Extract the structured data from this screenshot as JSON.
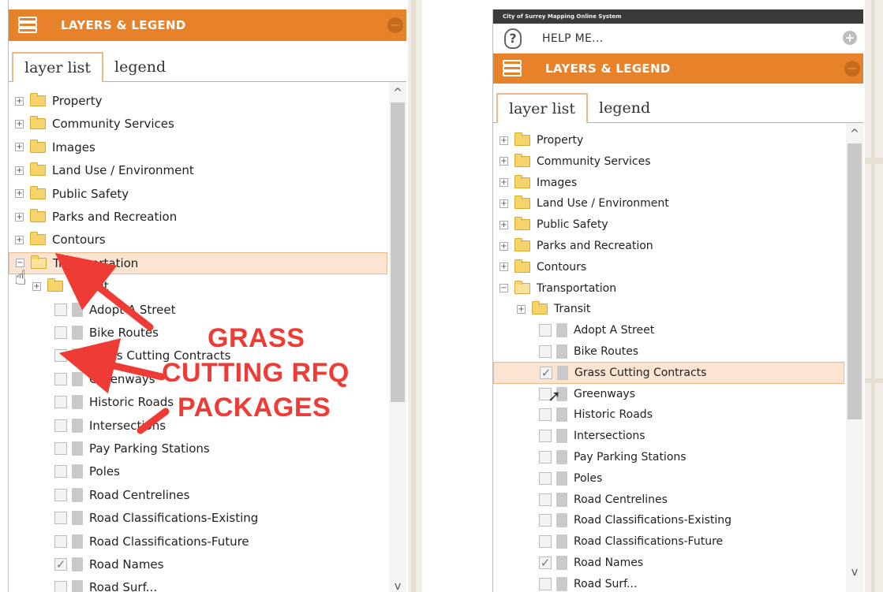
{
  "left": {
    "header_title": "LAYERS & LEGEND",
    "tabs": [
      "layer list",
      "legend"
    ],
    "items": [
      {
        "kind": "folder",
        "expander": "+",
        "label": "Property"
      },
      {
        "kind": "folder",
        "expander": "+",
        "label": "Community Services"
      },
      {
        "kind": "folder",
        "expander": "+",
        "label": "Images"
      },
      {
        "kind": "folder",
        "expander": "+",
        "label": "Land Use / Environment"
      },
      {
        "kind": "folder",
        "expander": "+",
        "label": "Public Safety"
      },
      {
        "kind": "folder",
        "expander": "+",
        "label": "Parks and Recreation"
      },
      {
        "kind": "folder",
        "expander": "+",
        "label": "Contours"
      },
      {
        "kind": "folder",
        "expander": "−",
        "label": "Transportation",
        "open": true,
        "selected": true
      },
      {
        "kind": "folder",
        "expander": "+",
        "label": "Transit",
        "indent": 1
      },
      {
        "kind": "layer",
        "label": "Adopt A Street",
        "checked": false
      },
      {
        "kind": "layer",
        "label": "Bike Routes",
        "checked": false
      },
      {
        "kind": "layer",
        "label": "Grass Cutting Contracts",
        "checked": false
      },
      {
        "kind": "layer",
        "label": "Greenways",
        "checked": false
      },
      {
        "kind": "layer",
        "label": "Historic Roads",
        "checked": false
      },
      {
        "kind": "layer",
        "label": "Intersections",
        "checked": false
      },
      {
        "kind": "layer",
        "label": "Pay Parking Stations",
        "checked": false
      },
      {
        "kind": "layer",
        "label": "Poles",
        "checked": false
      },
      {
        "kind": "layer",
        "label": "Road Centrelines",
        "checked": false
      },
      {
        "kind": "layer",
        "label": "Road Classifications-Existing",
        "checked": false
      },
      {
        "kind": "layer",
        "label": "Road Classifications-Future",
        "checked": false
      },
      {
        "kind": "layer",
        "label": "Road Names",
        "checked": true
      },
      {
        "kind": "layer",
        "label": "Road Surf...",
        "checked": false
      }
    ]
  },
  "annotation": {
    "lines": [
      "GRASS",
      "CUTTING RFQ",
      "PACKAGES"
    ],
    "color": "#ef3b36"
  },
  "right": {
    "app_banner": "City of Surrey Mapping Online System",
    "help_label": "HELP ME...",
    "header_title": "LAYERS & LEGEND",
    "tabs": [
      "layer list",
      "legend"
    ],
    "items": [
      {
        "kind": "folder",
        "expander": "+",
        "label": "Property"
      },
      {
        "kind": "folder",
        "expander": "+",
        "label": "Community Services"
      },
      {
        "kind": "folder",
        "expander": "+",
        "label": "Images"
      },
      {
        "kind": "folder",
        "expander": "+",
        "label": "Land Use / Environment"
      },
      {
        "kind": "folder",
        "expander": "+",
        "label": "Public Safety"
      },
      {
        "kind": "folder",
        "expander": "+",
        "label": "Parks and Recreation"
      },
      {
        "kind": "folder",
        "expander": "+",
        "label": "Contours"
      },
      {
        "kind": "folder",
        "expander": "−",
        "label": "Transportation",
        "open": true
      },
      {
        "kind": "folder",
        "expander": "+",
        "label": "Transit",
        "indent": 1
      },
      {
        "kind": "layer",
        "label": "Adopt A Street",
        "checked": false
      },
      {
        "kind": "layer",
        "label": "Bike Routes",
        "checked": false
      },
      {
        "kind": "layer",
        "label": "Grass Cutting Contracts",
        "checked": true,
        "selected": true
      },
      {
        "kind": "layer",
        "label": "Greenways",
        "checked": false
      },
      {
        "kind": "layer",
        "label": "Historic Roads",
        "checked": false
      },
      {
        "kind": "layer",
        "label": "Intersections",
        "checked": false
      },
      {
        "kind": "layer",
        "label": "Pay Parking Stations",
        "checked": false
      },
      {
        "kind": "layer",
        "label": "Poles",
        "checked": false
      },
      {
        "kind": "layer",
        "label": "Road Centrelines",
        "checked": false
      },
      {
        "kind": "layer",
        "label": "Road Classifications-Existing",
        "checked": false
      },
      {
        "kind": "layer",
        "label": "Road Classifications-Future",
        "checked": false
      },
      {
        "kind": "layer",
        "label": "Road Names",
        "checked": true
      },
      {
        "kind": "layer",
        "label": "Road Surf...",
        "checked": false
      }
    ]
  },
  "colors": {
    "header_orange": "#e8822a",
    "selection_fill": "#fbe5d2",
    "annotation_red": "#ef3b36"
  },
  "icons": [
    "layers-icon",
    "help-icon",
    "plus-circle-icon",
    "collapse-icon",
    "folder-icon",
    "file-icon",
    "checkbox-icon",
    "hand-cursor-icon",
    "arrow-cursor-icon",
    "scroll-up-icon",
    "scroll-down-icon"
  ]
}
